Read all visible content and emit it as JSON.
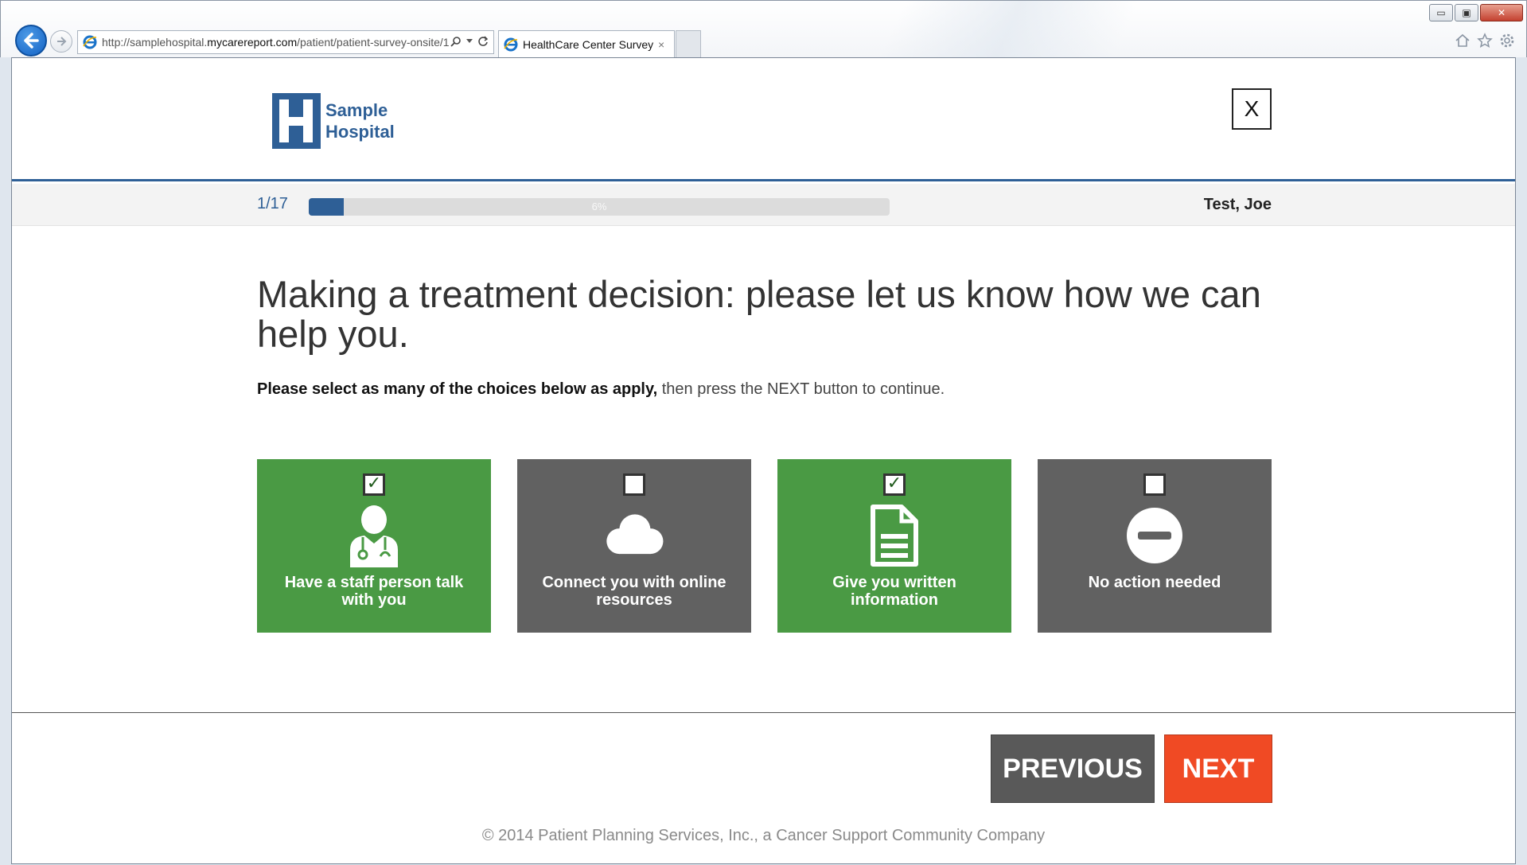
{
  "browser": {
    "url_prefix": "http://samplehospital.",
    "url_domain": "mycarereport.com",
    "url_path": "/patient/patient-survey-onsite/1",
    "tab_title": "HealthCare Center Survey",
    "tab_close": "×",
    "win_min": "▭",
    "win_max": "▣",
    "win_close": "✕"
  },
  "header": {
    "logo_line1": "Sample",
    "logo_line2": "Hospital",
    "close_label": "X",
    "brand_color": "#2e5f96"
  },
  "progress": {
    "step": "1/17",
    "percent_label": "6%",
    "fraction": 0.06,
    "user": "Test, Joe"
  },
  "question": {
    "title": "Making a treatment decision: please let us know how we can help you.",
    "instruction_bold": "Please select as many of the choices below as apply,",
    "instruction_rest": " then press the NEXT button to continue."
  },
  "choices": [
    {
      "label": "Have a staff person talk with you",
      "checked": true,
      "icon": "doctor-icon"
    },
    {
      "label": "Connect you with online resources",
      "checked": false,
      "icon": "cloud-icon"
    },
    {
      "label": "Give you written information",
      "checked": true,
      "icon": "document-icon"
    },
    {
      "label": "No action needed",
      "checked": false,
      "icon": "no-entry-icon"
    }
  ],
  "colors": {
    "selected": "#4a9a44",
    "unselected": "#616161",
    "next": "#f04a24",
    "previous": "#595959"
  },
  "footer": {
    "previous_label": "PREVIOUS",
    "next_label": "NEXT",
    "copyright": "© 2014 Patient Planning Services, Inc., a Cancer Support Community Company"
  }
}
